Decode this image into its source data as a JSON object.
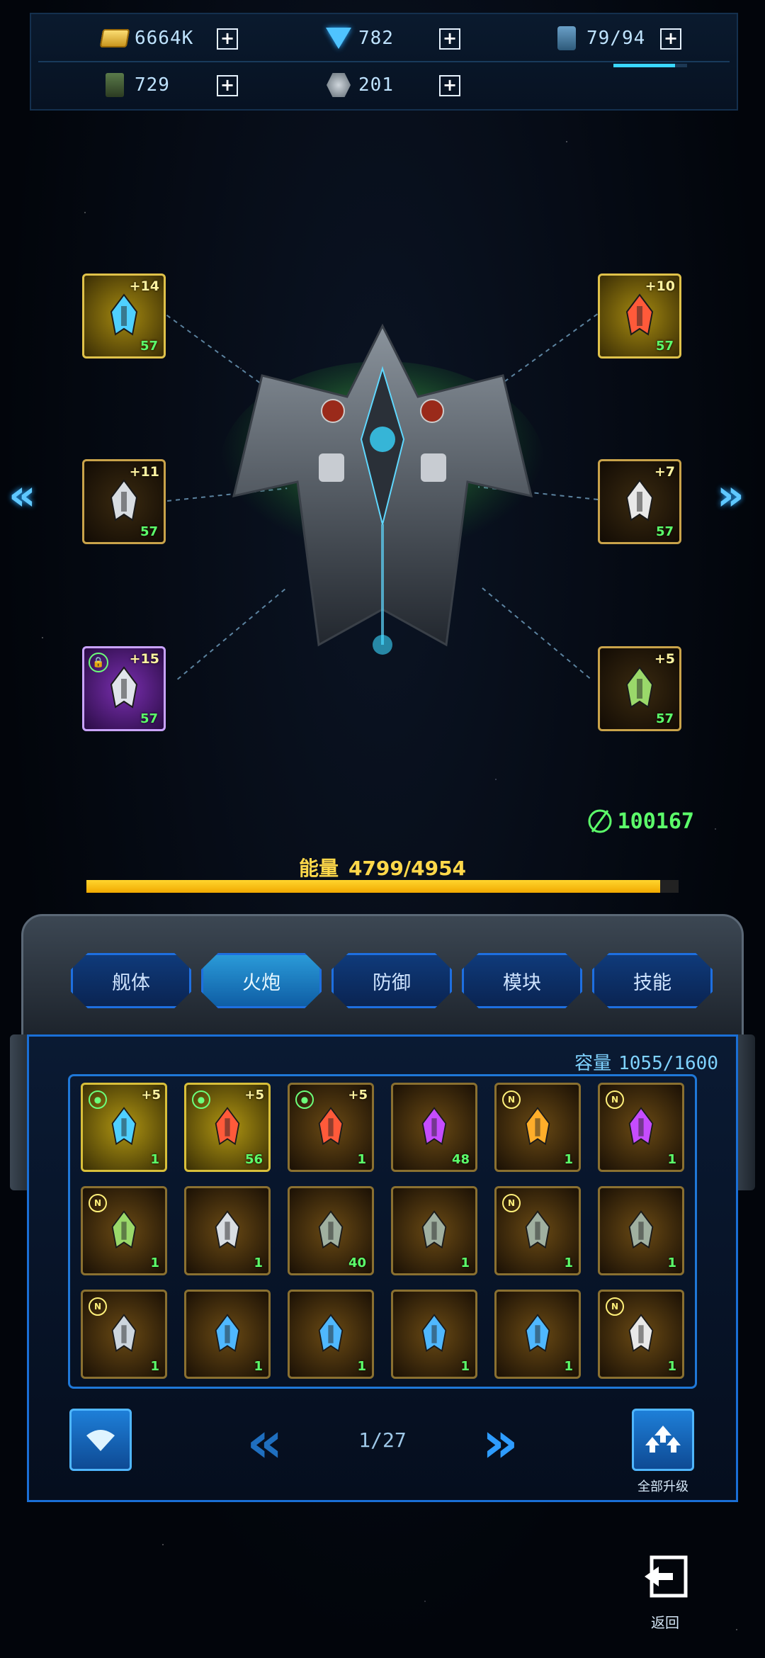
{
  "resources": {
    "gold": "6664K",
    "gems": "782",
    "fuel": "79/94",
    "fuel_fraction": 0.84,
    "parts": "729",
    "alloy": "201",
    "plus": "+"
  },
  "equipped_slots": [
    {
      "level": "+14",
      "count": "57",
      "rarity": "yellow",
      "icon": "cannon-blue-icon"
    },
    {
      "level": "+10",
      "count": "57",
      "rarity": "yellow",
      "icon": "cannon-red-icon"
    },
    {
      "level": "+11",
      "count": "57",
      "rarity": "orange",
      "icon": "turret-silver-icon"
    },
    {
      "level": "+7",
      "count": "57",
      "rarity": "orange",
      "icon": "claw-cannon-icon"
    },
    {
      "level": "+15",
      "count": "57",
      "rarity": "purple",
      "icon": "twin-missile-icon",
      "locked": true
    },
    {
      "level": "+5",
      "count": "57",
      "rarity": "orange",
      "icon": "green-turret-icon"
    }
  ],
  "nav": {
    "prev": "«",
    "next": "»"
  },
  "combat_power": "100167",
  "energy": {
    "label": "能量",
    "value": "4799/4954",
    "fraction": 0.969
  },
  "tabs": [
    "舰体",
    "火炮",
    "防御",
    "模块",
    "技能"
  ],
  "active_tab": 1,
  "capacity": {
    "label": "容量",
    "value": "1055/1600"
  },
  "inventory": [
    {
      "badge": "lock",
      "level": "+5",
      "count": "1",
      "rarity": "yellow",
      "icon": "cannon-blue-icon"
    },
    {
      "badge": "lock",
      "level": "+5",
      "count": "56",
      "rarity": "yellow",
      "icon": "cannon-red-icon"
    },
    {
      "badge": "lock",
      "level": "+5",
      "count": "1",
      "rarity": "orange",
      "icon": "cannon-red-icon"
    },
    {
      "badge": "",
      "level": "",
      "count": "48",
      "rarity": "orange",
      "icon": "purple-crystal-icon"
    },
    {
      "badge": "N",
      "level": "",
      "count": "1",
      "rarity": "orange",
      "icon": "flame-crystal-icon"
    },
    {
      "badge": "N",
      "level": "",
      "count": "1",
      "rarity": "orange",
      "icon": "purple-crystal-icon"
    },
    {
      "badge": "N",
      "level": "",
      "count": "1",
      "rarity": "orange",
      "icon": "green-turret-icon"
    },
    {
      "badge": "",
      "level": "",
      "count": "1",
      "rarity": "orange",
      "icon": "turret-silver-icon"
    },
    {
      "badge": "",
      "level": "",
      "count": "40",
      "rarity": "orange",
      "icon": "shield-module-icon"
    },
    {
      "badge": "",
      "level": "",
      "count": "1",
      "rarity": "orange",
      "icon": "shield-module-icon"
    },
    {
      "badge": "N",
      "level": "",
      "count": "1",
      "rarity": "orange",
      "icon": "shield-module-icon"
    },
    {
      "badge": "",
      "level": "",
      "count": "1",
      "rarity": "orange",
      "icon": "shield-module-icon"
    },
    {
      "badge": "N",
      "level": "",
      "count": "1",
      "rarity": "orange",
      "icon": "pod-turret-icon"
    },
    {
      "badge": "",
      "level": "",
      "count": "1",
      "rarity": "orange",
      "icon": "engine-cylinder-icon"
    },
    {
      "badge": "",
      "level": "",
      "count": "1",
      "rarity": "orange",
      "icon": "engine-cylinder-icon"
    },
    {
      "badge": "",
      "level": "",
      "count": "1",
      "rarity": "orange",
      "icon": "engine-cylinder-icon"
    },
    {
      "badge": "",
      "level": "",
      "count": "1",
      "rarity": "orange",
      "icon": "engine-cylinder-icon"
    },
    {
      "badge": "N",
      "level": "",
      "count": "1",
      "rarity": "orange",
      "icon": "claw-cannon-icon"
    }
  ],
  "page_indicator": "1/27",
  "upgrade_all_label": "全部升级",
  "back_label": "返回"
}
